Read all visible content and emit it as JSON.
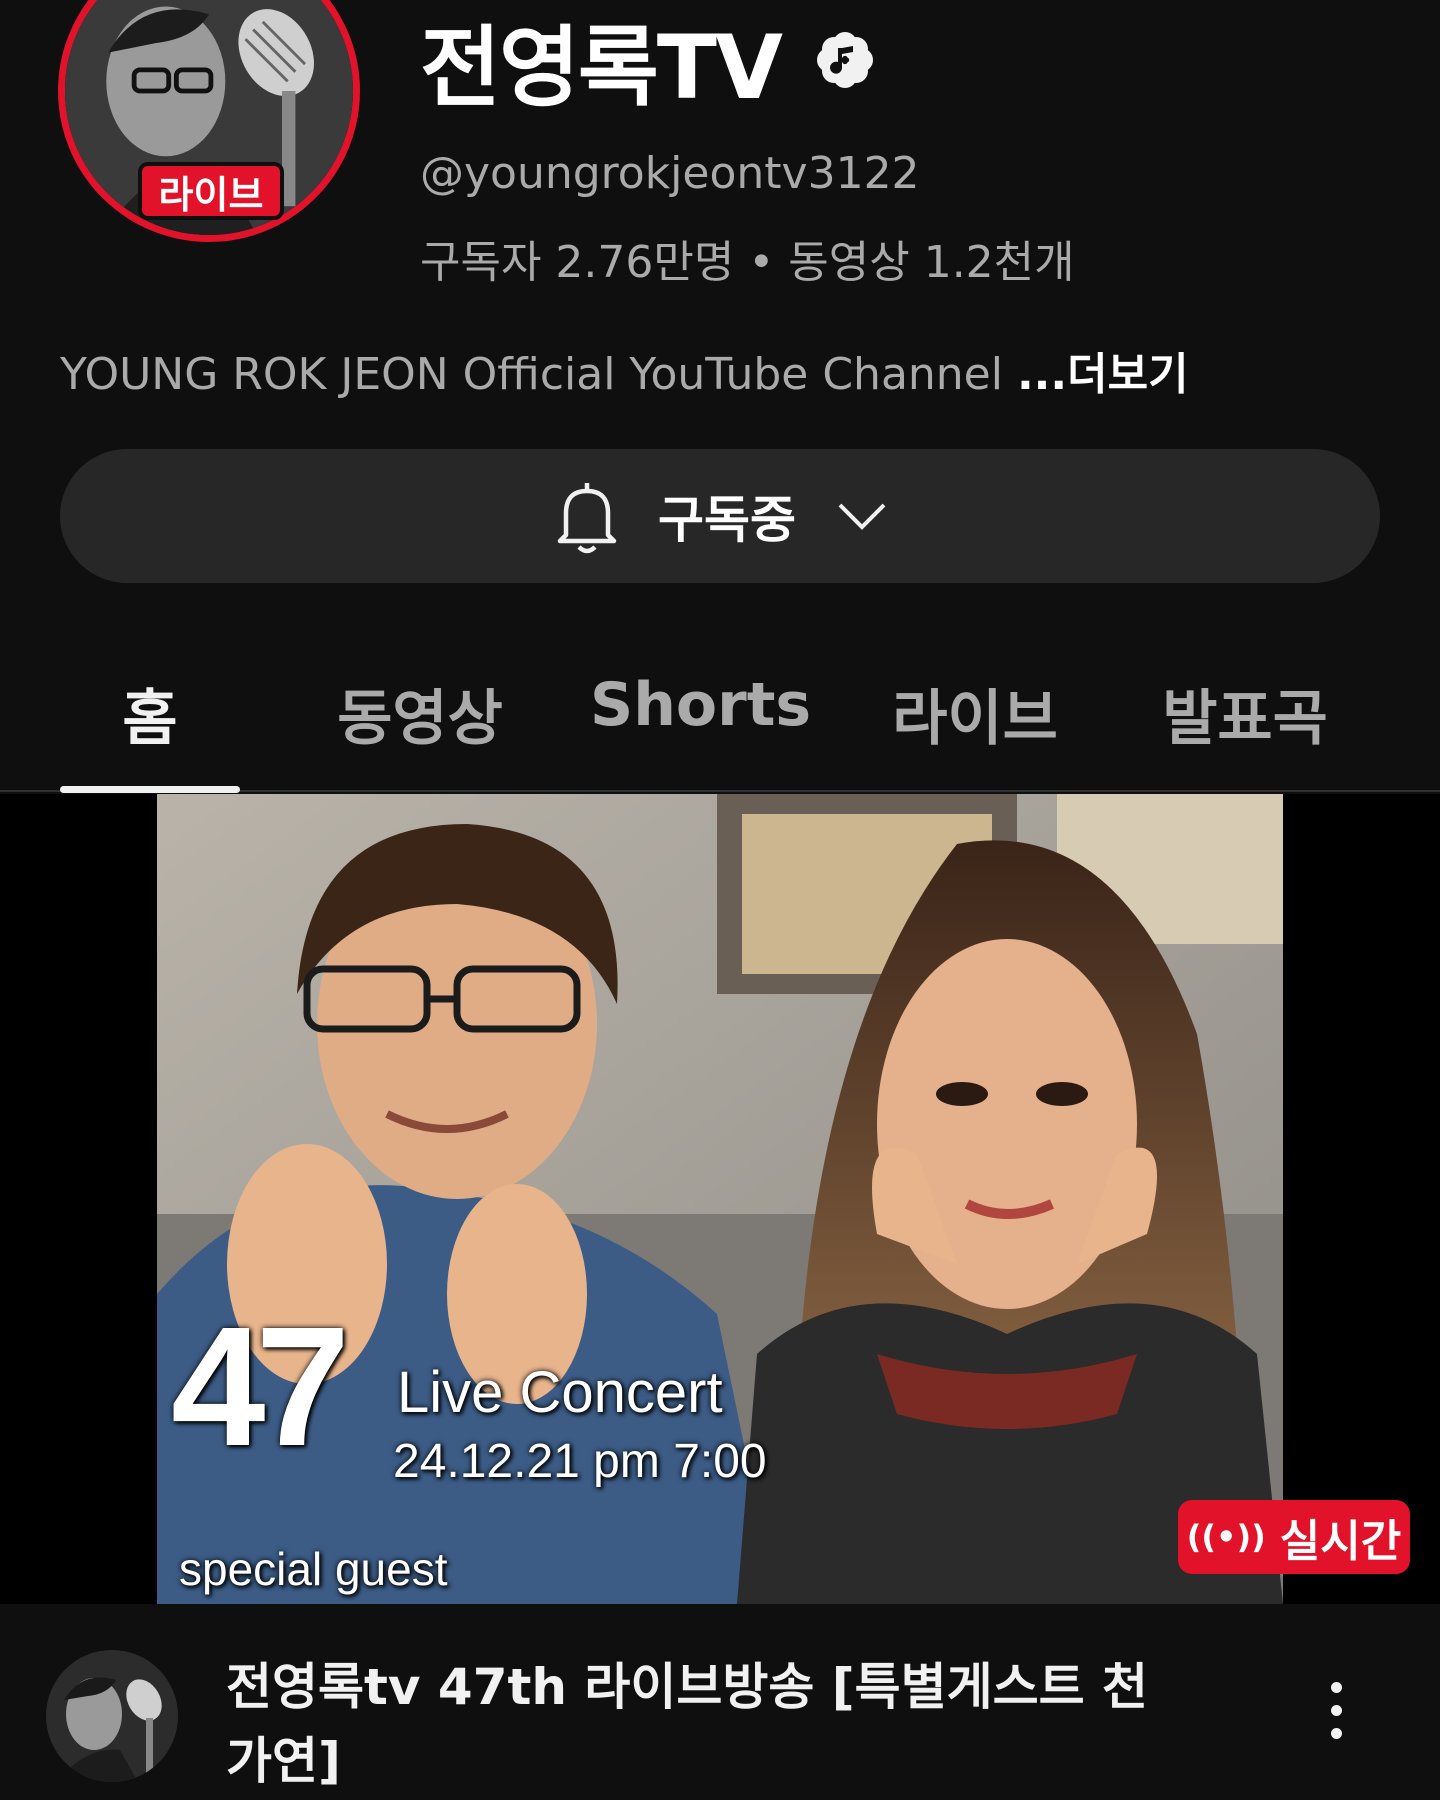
{
  "channel": {
    "name": "전영록TV",
    "handle": "@youngrokjeontv3122",
    "stats": "구독자 2.76만명 • 동영상 1.2천개",
    "description": "YOUNG ROK JEON  Official YouTube Channel ",
    "more_label": "...더보기",
    "live_badge": "라이브"
  },
  "subscribe": {
    "label": "구독중",
    "icon": "bell-icon"
  },
  "tabs": [
    {
      "label": "홈",
      "active": true
    },
    {
      "label": "동영상",
      "active": false
    },
    {
      "label": "Shorts",
      "active": false
    },
    {
      "label": "라이브",
      "active": false
    },
    {
      "label": "발표곡",
      "active": false
    }
  ],
  "video": {
    "thumbnail_text": {
      "number": "47",
      "concert": "Live Concert",
      "date": "24.12.21 pm 7:00",
      "guest": "special guest"
    },
    "live_chip": {
      "icon": "((•))",
      "label": "실시간"
    },
    "title": "전영록tv 47th 라이브방송 [특별게스트 천가연]"
  },
  "colors": {
    "background": "#0f0f0f",
    "live_red": "#e3122b",
    "button_bg": "#272727",
    "secondary_text": "#aaaaaa"
  }
}
